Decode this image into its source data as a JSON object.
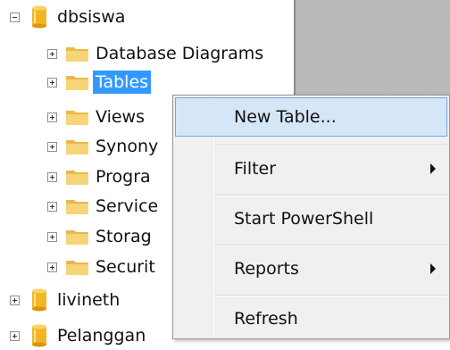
{
  "tree": {
    "database": {
      "name": "dbsiswa",
      "expanded": true
    },
    "folders": [
      {
        "label": "Database Diagrams",
        "selected": false
      },
      {
        "label": "Tables",
        "selected": true
      },
      {
        "label": "Views",
        "selected": false
      },
      {
        "label": "Synony",
        "selected": false
      },
      {
        "label": "Progra",
        "selected": false
      },
      {
        "label": "Service",
        "selected": false
      },
      {
        "label": "Storag",
        "selected": false
      },
      {
        "label": "Securit",
        "selected": false
      }
    ],
    "databases_below": [
      {
        "name": "livineth",
        "expanded": false
      },
      {
        "name": "Pelanggan",
        "expanded": false
      }
    ]
  },
  "context_menu": {
    "items": [
      {
        "label": "New Table...",
        "highlighted": true,
        "submenu": false
      },
      {
        "label": "Filter",
        "submenu": true
      },
      {
        "label": "Start PowerShell",
        "submenu": false
      },
      {
        "label": "Reports",
        "submenu": true
      },
      {
        "label": "Refresh",
        "submenu": false
      }
    ]
  },
  "colors": {
    "selection": "#3399ff",
    "menu_highlight": "#d5e6f7",
    "menu_background": "#f0f0f0",
    "folder": "#f0c95a",
    "database": "#f2b524"
  },
  "icons": {
    "expand": "plus-box",
    "collapse": "minus-box",
    "database": "database-cylinder",
    "folder": "folder",
    "submenu": "right-triangle"
  }
}
